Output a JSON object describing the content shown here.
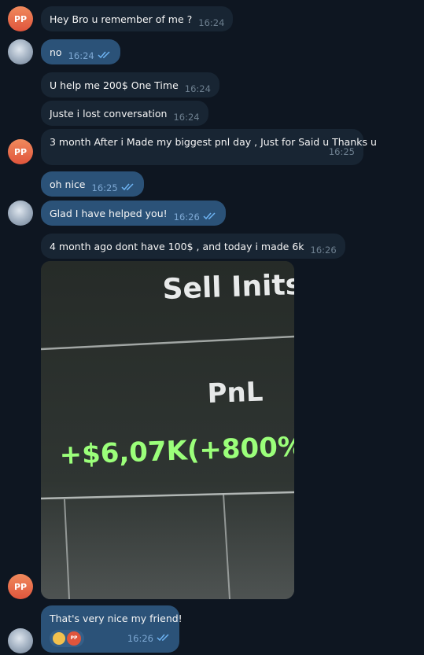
{
  "messages": [
    {
      "text": "Hey Bro u remember of me ?",
      "time": "16:24"
    },
    {
      "text": "no",
      "time": "16:24"
    },
    {
      "text": "U help me 200$ One Time",
      "time": "16:24"
    },
    {
      "text": "Juste i lost conversation",
      "time": "16:24"
    },
    {
      "text": "3 month After i Made my biggest pnl day , Just for Said u Thanks u",
      "time": "16:25"
    },
    {
      "text": "oh nice",
      "time": "16:25"
    },
    {
      "text": "Glad I have helped you!",
      "time": "16:26"
    },
    {
      "text": "4 month ago dont have 100$ , and today i made 6k",
      "time": "16:26"
    },
    {
      "text": "That's very nice my friend!",
      "time": "16:26"
    }
  ],
  "photo": {
    "line1": "Sell Inits",
    "line2": "PnL",
    "line3": "+$6,07K(+800%"
  },
  "avatars": {
    "contact_initials": "PP",
    "reaction_initials": "PP"
  },
  "colors": {
    "incoming": "#182533",
    "outgoing": "#2b5278",
    "background": "#0e1621",
    "pnl_green": "#9bff7a"
  }
}
